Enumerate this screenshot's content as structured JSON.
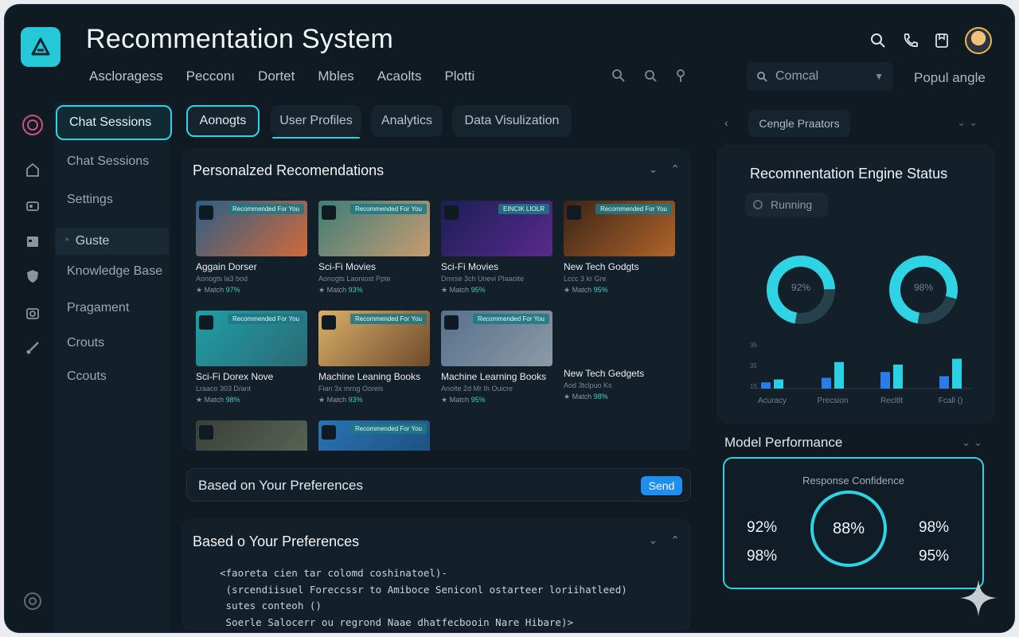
{
  "app": {
    "title": "Recommentation System"
  },
  "header": {
    "nav": [
      "Ascloragess",
      "Pecconı‌",
      "Dortet",
      "Mbles",
      "Acaolts",
      "Plotti"
    ],
    "combo_value": "Comcal",
    "popular": "Popul angle",
    "icons": [
      "search-icon",
      "phone-icon",
      "card-icon",
      "user-avatar"
    ]
  },
  "sidebar": {
    "active": "Chat Sessions",
    "items": [
      "Chat Sessions",
      "Settings",
      "Guste",
      "Knowledge Base",
      "Pragament",
      "Crouts",
      "Ccouts"
    ]
  },
  "tabs": [
    "Aonogts",
    "User Profiles",
    "Analytics",
    "Data Visulization"
  ],
  "recommendations": {
    "title": "Personalzed Recomendations",
    "cards": [
      {
        "title": "Aggain Dorser",
        "sub": "Aonogts la3 bod",
        "match": "Match",
        "pct": "97%",
        "badge": "Recommended For You",
        "colors": [
          "#2d5d86",
          "#d06a3a"
        ]
      },
      {
        "title": "Sci-Fi Movies",
        "sub": "Aonogts Laoniost Ppte",
        "match": "Match",
        "pct": "93%",
        "badge": "Recommended For You",
        "colors": [
          "#3e7d76",
          "#c79b72"
        ]
      },
      {
        "title": "Sci-Fi Movies",
        "sub": "Dmrse 3ch Unevi Plaaoite",
        "match": "Match",
        "pct": "95%",
        "badge": "EINCIK LIOLR",
        "colors": [
          "#1a1f55",
          "#5a2a8c"
        ]
      },
      {
        "title": "New Tech Godgts",
        "sub": "Lccc 3 kr Gre",
        "match": "Match",
        "pct": "95%",
        "badge": "Recommended For You",
        "colors": [
          "#3a2417",
          "#b0642a"
        ]
      },
      {
        "title": "Sci-Fi Dorex Nove",
        "sub": "Lraaco 303 D/ant",
        "match": "Match",
        "pct": "98%",
        "badge": "Recommended For You",
        "colors": [
          "#1f9ea6",
          "#2b6a74"
        ]
      },
      {
        "title": "Machine Leaning Books",
        "sub": "Fian 3x mrng Ooreis",
        "match": "Match",
        "pct": "93%",
        "badge": "Recommended For You",
        "colors": [
          "#d9b06a",
          "#6e4a2b"
        ]
      },
      {
        "title": "Machine Learning Books",
        "sub": "Anolte 2d Mr Ih Ouicre",
        "match": "Match",
        "pct": "95%",
        "badge": "Recommended For You",
        "colors": [
          "#56708c",
          "#8b9aa6"
        ]
      },
      {
        "title": "New Tech Gedgets",
        "sub": "Aod 3tclpuo Ks",
        "match": "Match",
        "pct": "98%",
        "badge": "",
        "colors": [
          "#142029",
          "#142029"
        ]
      },
      {
        "title": "",
        "sub": "",
        "match": "",
        "pct": "",
        "badge": "",
        "colors": [
          "#3a3f3a",
          "#5b6a58"
        ]
      },
      {
        "title": "",
        "sub": "",
        "match": "",
        "pct": "",
        "badge": "Recommended For You",
        "colors": [
          "#2a73b4",
          "#1b4c7a"
        ]
      }
    ]
  },
  "input": {
    "placeholder": "Based on Your Preferences",
    "send": "Send"
  },
  "preferences": {
    "title": "Based o Your Preferences",
    "code": [
      "<faoreta cien tar colomd coshinatoel)-",
      " (srcendiisuel Foreccssr to Amiboce Seniconl ostarteer loriihatleed)",
      " sutes conteoh ()",
      " Soerle Salocerr ou regrond Naae dhatfecbooin Nare Hibare)>"
    ]
  },
  "right": {
    "chip": "Cengle Praators",
    "status_title": "Recomnentation Engine Status",
    "status": "Running",
    "donuts": [
      {
        "label": "92%",
        "value": 0.92
      },
      {
        "label": "98%",
        "value": 0.98
      }
    ],
    "bars": {
      "categories": [
        "Acuracy",
        "Precsion",
        "Recltlt",
        "Fcall ()"
      ],
      "values": [
        [
          0.15,
          0.22
        ],
        [
          0.26,
          0.64
        ],
        [
          0.4,
          0.58
        ],
        [
          0.3,
          0.72
        ]
      ],
      "y_ticks": [
        "35",
        "35",
        "15"
      ]
    },
    "mp_title": "Model Performance",
    "confidence_title": "Response Confidence",
    "confidence": "88%",
    "left_vals": [
      "92%",
      "98%"
    ],
    "right_vals": [
      "98%",
      "95%"
    ]
  },
  "colors": {
    "accent": "#2ed4e4",
    "send": "#1e8ef0",
    "bg": "#0f1a23",
    "panel": "#142029"
  }
}
